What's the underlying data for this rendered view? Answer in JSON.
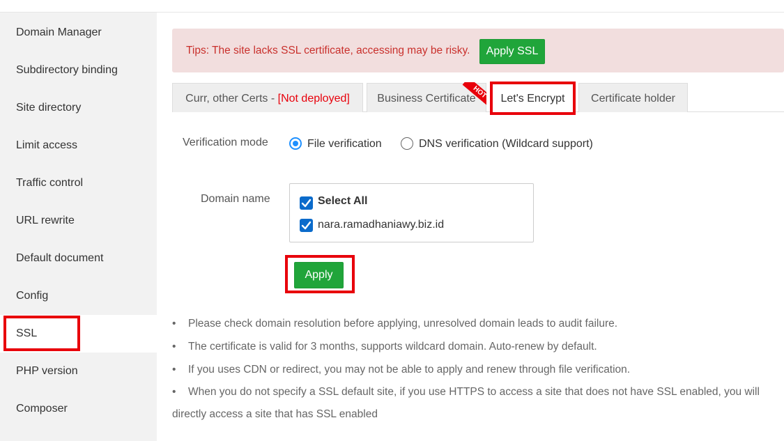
{
  "sidebar": {
    "items": [
      {
        "label": "Domain Manager"
      },
      {
        "label": "Subdirectory binding"
      },
      {
        "label": "Site directory"
      },
      {
        "label": "Limit access"
      },
      {
        "label": "Traffic control"
      },
      {
        "label": "URL rewrite"
      },
      {
        "label": "Default document"
      },
      {
        "label": "Config"
      },
      {
        "label": "SSL"
      },
      {
        "label": "PHP version"
      },
      {
        "label": "Composer"
      }
    ],
    "active": "SSL"
  },
  "tips": {
    "text": "Tips: The site lacks SSL certificate, accessing may be risky.",
    "button": "Apply SSL"
  },
  "tabs": [
    {
      "label": "Curr, other Certs - ",
      "status": "[Not deployed]"
    },
    {
      "label": "Business Certificate",
      "badge": "HOT"
    },
    {
      "label": "Let's Encrypt",
      "active": true
    },
    {
      "label": "Certificate holder"
    }
  ],
  "form": {
    "verification_label": "Verification mode",
    "options": [
      {
        "label": "File verification",
        "selected": true
      },
      {
        "label": "DNS verification (Wildcard support)",
        "selected": false
      }
    ],
    "domain_label": "Domain name",
    "domains": [
      {
        "label": "Select All",
        "checked": true
      },
      {
        "label": "nara.ramadhaniawy.biz.id",
        "checked": true
      }
    ],
    "apply_button": "Apply"
  },
  "notes": [
    "Please check domain resolution before applying, unresolved domain leads to audit failure.",
    "The certificate is valid for 3 months, supports wildcard domain. Auto-renew by default.",
    "If you uses CDN or redirect, you may not be able to apply and renew through file verification.",
    "When you do not specify a SSL default site, if you use HTTPS to access a site that does not have SSL enabled, you will",
    "directly access a site that has SSL enabled"
  ],
  "colors": {
    "accent_green": "#20a53a",
    "highlight_red": "#e8000b",
    "tips_bg": "#f2dede",
    "checkbox_blue": "#0b6bcb"
  }
}
